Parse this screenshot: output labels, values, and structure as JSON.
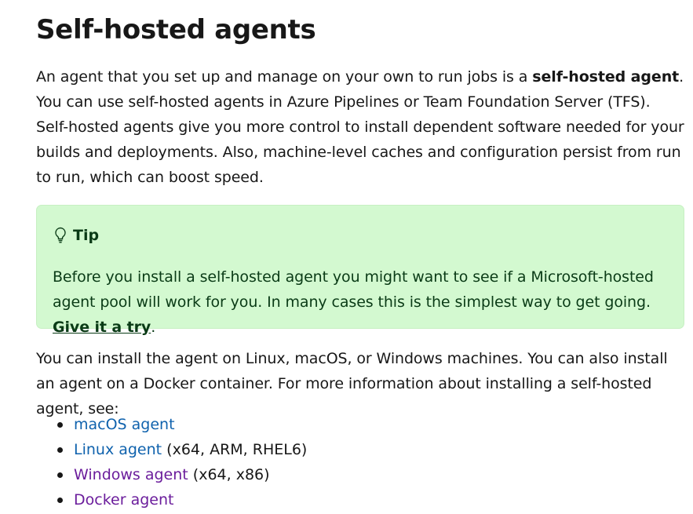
{
  "heading": "Self-hosted agents",
  "intro": {
    "before_bold": "An agent that you set up and manage on your own to run jobs is a ",
    "bold": "self-hosted agent",
    "after_bold": ". You can use self-hosted agents in Azure Pipelines or Team Foundation Server (TFS). Self-hosted agents give you more control to install dependent software needed for your builds and deployments. Also, machine-level caches and configuration persist from run to run, which can boost speed."
  },
  "tip": {
    "icon": "lightbulb-icon",
    "title": "Tip",
    "text_before_link": "Before you install a self-hosted agent you might want to see if a Microsoft-hosted agent pool will work for you. In many cases this is the simplest way to get going. ",
    "link": "Give it a try",
    "text_after_link": ".",
    "background_color": "#d3f9d0",
    "text_color": "#0a3b16"
  },
  "install_text": "You can install the agent on Linux, macOS, or Windows machines. You can also install an agent on a Docker container. For more information about installing a self-hosted agent, see:",
  "agents": [
    {
      "link": "macOS agent",
      "suffix": "",
      "link_color": "#0f62ad"
    },
    {
      "link": "Linux agent",
      "suffix": " (x64, ARM, RHEL6)",
      "link_color": "#0f62ad"
    },
    {
      "link": "Windows agent",
      "suffix": " (x64, x86)",
      "link_color": "#6b1d9c"
    },
    {
      "link": "Docker agent",
      "suffix": "",
      "link_color": "#6b1d9c"
    }
  ]
}
